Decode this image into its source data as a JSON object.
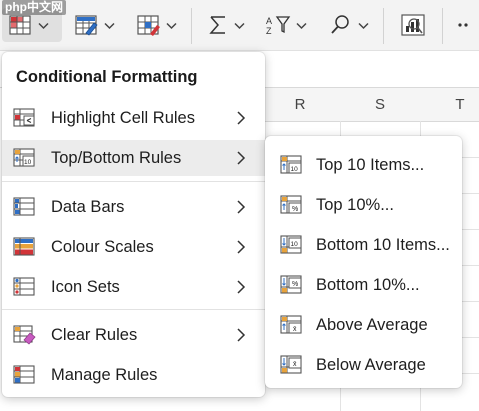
{
  "watermark": "php中文网",
  "ribbon": {
    "buttons": [
      {
        "name": "conditional-formatting-button",
        "icon": "conditional-formatting-icon"
      },
      {
        "name": "format-as-table-button",
        "icon": "format-as-table-icon"
      },
      {
        "name": "cell-styles-button",
        "icon": "cell-styles-icon"
      },
      {
        "name": "autosum-button",
        "icon": "sigma-icon"
      },
      {
        "name": "sort-filter-button",
        "icon": "sort-filter-icon"
      },
      {
        "name": "find-select-button",
        "icon": "magnifier-icon"
      },
      {
        "name": "analyse-data-button",
        "icon": "analyse-data-icon"
      },
      {
        "name": "more-options-button",
        "icon": "ellipsis-icon"
      }
    ]
  },
  "sheet": {
    "columns": [
      "R",
      "S",
      "T"
    ]
  },
  "menu": {
    "title": "Conditional Formatting",
    "items": [
      {
        "label": "Highlight Cell Rules",
        "icon": "highlight-cell-rules-icon",
        "has_submenu": true
      },
      {
        "label": "Top/Bottom Rules",
        "icon": "top-bottom-rules-icon",
        "has_submenu": true,
        "active": true
      },
      {
        "label": "Data Bars",
        "icon": "data-bars-icon",
        "has_submenu": true
      },
      {
        "label": "Colour Scales",
        "icon": "colour-scales-icon",
        "has_submenu": true
      },
      {
        "label": "Icon Sets",
        "icon": "icon-sets-icon",
        "has_submenu": true
      },
      {
        "label": "Clear Rules",
        "icon": "clear-rules-icon",
        "has_submenu": true
      },
      {
        "label": "Manage Rules",
        "icon": "manage-rules-icon",
        "has_submenu": false
      }
    ]
  },
  "submenu": {
    "items": [
      {
        "label": "Top 10 Items...",
        "icon": "top-10-items-icon",
        "badge": "10"
      },
      {
        "label": "Top 10%...",
        "icon": "top-10-percent-icon",
        "badge": "%"
      },
      {
        "label": "Bottom 10 Items...",
        "icon": "bottom-10-items-icon",
        "badge": "10"
      },
      {
        "label": "Bottom 10%...",
        "icon": "bottom-10-percent-icon",
        "badge": "%"
      },
      {
        "label": "Above Average",
        "icon": "above-average-icon",
        "badge": "x̄"
      },
      {
        "label": "Below Average",
        "icon": "below-average-icon",
        "badge": "x̄"
      }
    ]
  },
  "colors": {
    "accent_blue": "#2f6fc5",
    "accent_red": "#d13438",
    "accent_orange": "#e8a33c",
    "menu_hover": "#ececec"
  }
}
